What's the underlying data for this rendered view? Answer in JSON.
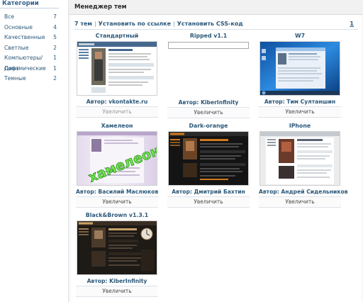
{
  "sidebar": {
    "title": "Категории",
    "items": [
      {
        "label": "Все",
        "count": "7"
      },
      {
        "label": "Основные",
        "count": "4"
      },
      {
        "label": "Качественные",
        "count": "5"
      },
      {
        "label": "Светлые",
        "count": "2"
      },
      {
        "label": "Компьютеры/Софт",
        "count": "1"
      },
      {
        "label": "Динамические",
        "count": "1"
      },
      {
        "label": "Темные",
        "count": "2"
      }
    ]
  },
  "main": {
    "title": "Менеджер тем",
    "tabs": {
      "count": "7 тем",
      "install_link": "Установить по ссылке",
      "install_css": "Установить CSS-код",
      "page": "1"
    },
    "themes": [
      {
        "title": "Стандартный",
        "author": "Автор: vkontakte.ru",
        "zoom": "Увеличить"
      },
      {
        "title": "Ripped v1.1",
        "author": "Автор: KiberInfinity",
        "zoom": "Увеличить"
      },
      {
        "title": "W7",
        "author": "Автор: Тим Султаншин",
        "zoom": "Увеличить"
      },
      {
        "title": "Хамелеон",
        "author": "Автор: Василий Маслюков",
        "zoom": "Увеличить",
        "thumb_text": "хамелеон"
      },
      {
        "title": "Dark-orange",
        "author": "Автор: Дмитрий Бахтин",
        "zoom": "Увеличить"
      },
      {
        "title": "IPhone",
        "author": "Автор: Андрей Сидельников",
        "zoom": "Увеличить"
      },
      {
        "title": "Black&Brown v1.3.1",
        "author": "Автор: KiberInfinity",
        "zoom": "Увеличить"
      }
    ]
  },
  "colors": {
    "link": "#2b587a",
    "vk_blue": "#45688e",
    "win7_blue": "#1e73c8",
    "dark_bg": "#1a1a1a",
    "orange": "#d07a1f"
  }
}
